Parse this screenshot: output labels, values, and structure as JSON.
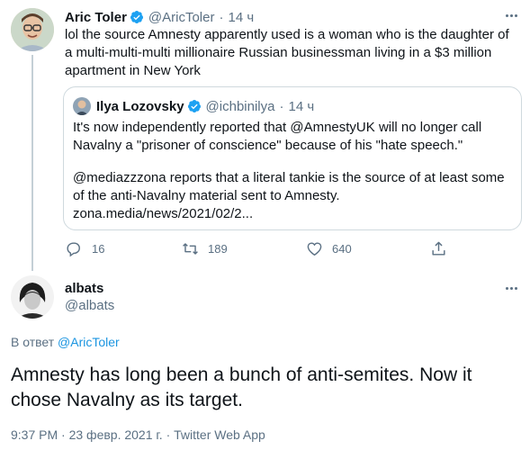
{
  "tweet1": {
    "display_name": "Aric Toler",
    "handle": "@AricToler",
    "separator": "·",
    "time": "14 ч",
    "text": "lol the source Amnesty apparently used is a woman who is the daughter of a multi-multi-multi millionaire Russian businessman living in a $3 million apartment in New York",
    "quoted": {
      "display_name": "Ilya Lozovsky",
      "handle": "@ichbinilya",
      "separator": "·",
      "time": "14 ч",
      "para1": "It's now independently reported that @AmnestyUK will no longer call Navalny a \"prisoner of conscience\" because of his \"hate speech.\"",
      "para2": "@mediazzzona reports that a literal tankie is the source of at least some of the anti-Navalny material sent to Amnesty.",
      "link": "zona.media/news/2021/02/2..."
    },
    "actions": {
      "replies": "16",
      "retweets": "189",
      "likes": "640"
    }
  },
  "tweet2": {
    "display_name": "albats",
    "handle": "@albats",
    "reply_prefix": "В ответ",
    "reply_to": "@AricToler",
    "text": "Amnesty has long been a bunch of anti-semites. Now it chose Navalny as its target.",
    "time": "9:37 PM",
    "date": "23 февр. 2021 г.",
    "separator": "·",
    "source": "Twitter Web App"
  },
  "colors": {
    "accent": "#1da1f2",
    "link": "#1b95e0",
    "muted": "#5b7083",
    "border": "#cfd9de"
  }
}
